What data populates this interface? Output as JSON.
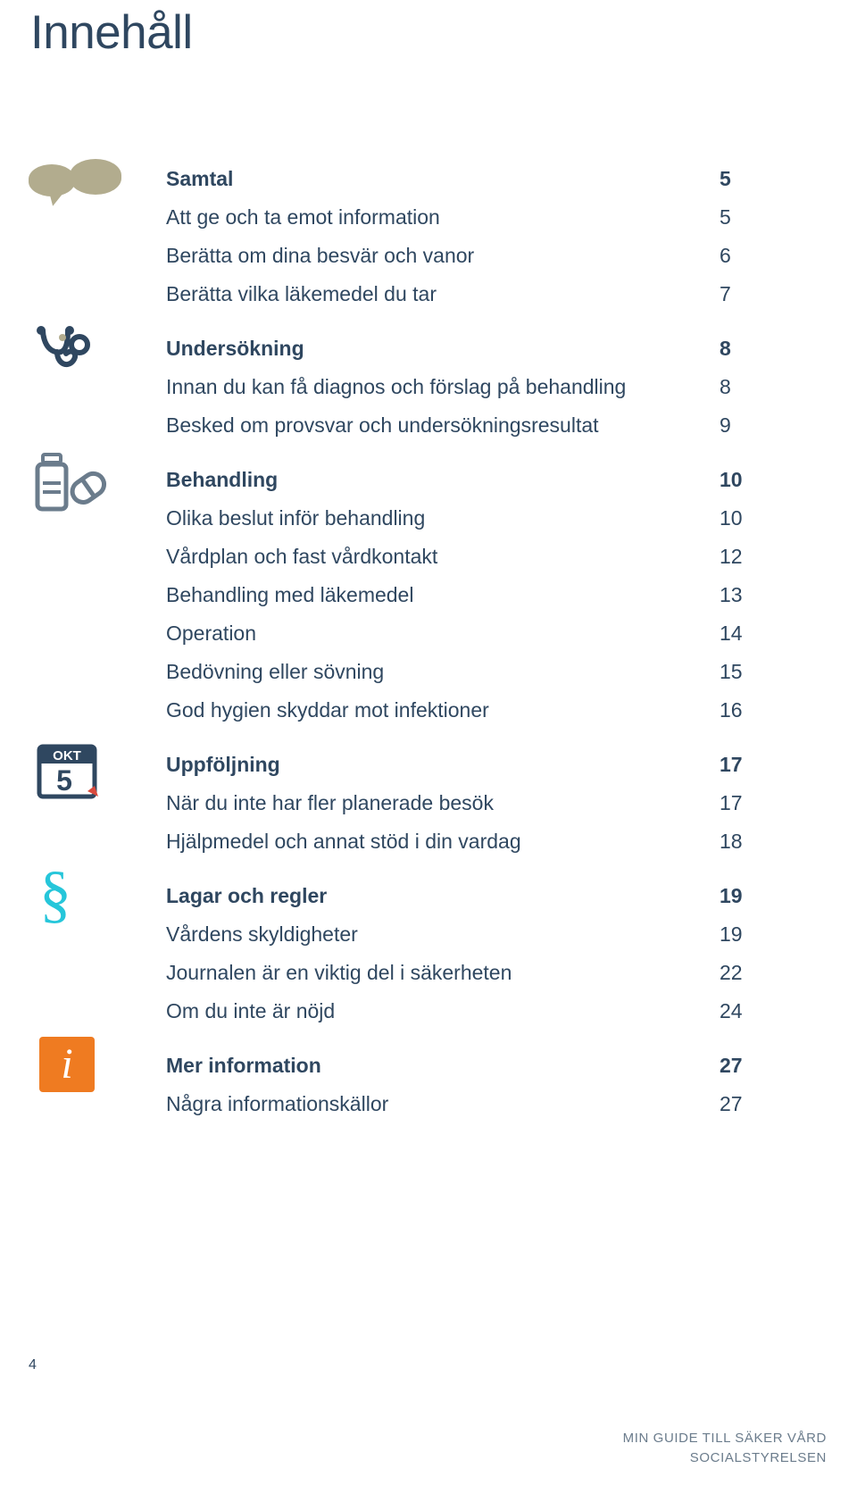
{
  "document": {
    "title": "Innehåll",
    "folio": "4",
    "footer": {
      "line1": "MIN GUIDE TILL SÄKER VÅRD",
      "line2": "SOCIALSTYRELSEN"
    }
  },
  "colors": {
    "text": "#2f4760",
    "bubble": "#b2ac8e",
    "steth": "#2f4760",
    "bottle": "#6b7c8c",
    "calendar": "#2f4760",
    "calendar_tab": "#d94a3d",
    "paragraph": "#26c6da",
    "info_bg": "#ef7b21"
  },
  "sections": [
    {
      "icon": "speech-bubbles-icon",
      "entries": [
        {
          "label": "Samtal",
          "page": "5",
          "head": true
        },
        {
          "label": "Att ge och ta emot information",
          "page": "5",
          "head": false
        },
        {
          "label": "Berätta om dina besvär och vanor",
          "page": "6",
          "head": false
        },
        {
          "label": "Berätta vilka läkemedel du tar",
          "page": "7",
          "head": false
        }
      ]
    },
    {
      "icon": "stethoscope-icon",
      "entries": [
        {
          "label": "Undersökning",
          "page": "8",
          "head": true
        },
        {
          "label": "Innan du kan få diagnos och förslag på behandling",
          "page": "8",
          "head": false
        },
        {
          "label": "Besked om provsvar och undersökningsresultat",
          "page": "9",
          "head": false
        }
      ]
    },
    {
      "icon": "medicine-bottle-icon",
      "entries": [
        {
          "label": "Behandling",
          "page": "10",
          "head": true
        },
        {
          "label": "Olika beslut inför behandling",
          "page": "10",
          "head": false
        },
        {
          "label": "Vårdplan och fast vårdkontakt",
          "page": "12",
          "head": false
        },
        {
          "label": "Behandling med läkemedel",
          "page": "13",
          "head": false
        },
        {
          "label": "Operation",
          "page": "14",
          "head": false
        },
        {
          "label": "Bedövning eller sövning",
          "page": "15",
          "head": false
        },
        {
          "label": "God hygien skyddar mot infektioner",
          "page": "16",
          "head": false
        }
      ]
    },
    {
      "icon": "calendar-icon",
      "calendar": {
        "month": "OKT",
        "day": "5"
      },
      "entries": [
        {
          "label": "Uppföljning",
          "page": "17",
          "head": true
        },
        {
          "label": "När du inte har fler planerade besök",
          "page": "17",
          "head": false
        },
        {
          "label": "Hjälpmedel och annat stöd i din vardag",
          "page": "18",
          "head": false
        }
      ]
    },
    {
      "icon": "paragraph-sign-icon",
      "glyph": "§",
      "entries": [
        {
          "label": "Lagar och regler",
          "page": "19",
          "head": true
        },
        {
          "label": "Vårdens skyldigheter",
          "page": "19",
          "head": false
        },
        {
          "label": "Journalen är en viktig del i säkerheten",
          "page": "22",
          "head": false
        },
        {
          "label": "Om du inte är nöjd",
          "page": "24",
          "head": false
        }
      ]
    },
    {
      "icon": "information-icon",
      "glyph": "i",
      "entries": [
        {
          "label": "Mer information",
          "page": "27",
          "head": true
        },
        {
          "label": "Några informationskällor",
          "page": "27",
          "head": false
        }
      ]
    }
  ]
}
